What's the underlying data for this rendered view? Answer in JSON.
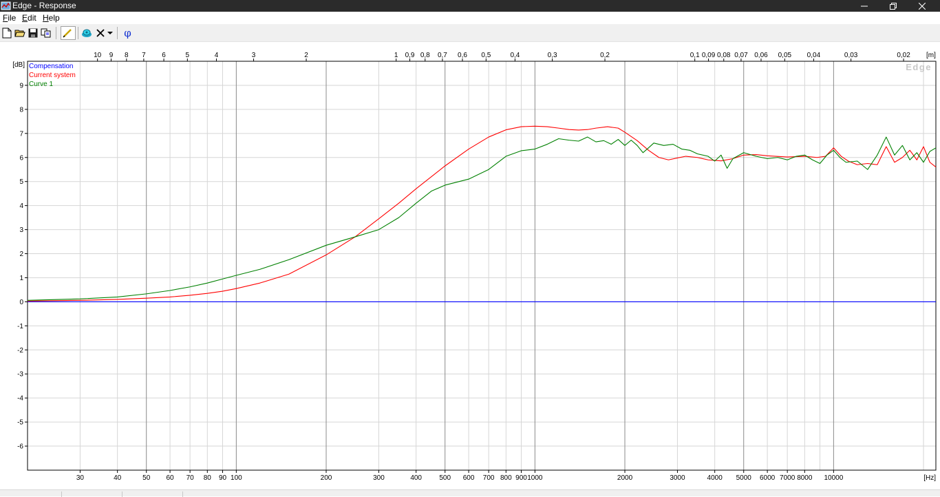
{
  "window": {
    "title": "Edge - Response"
  },
  "menu": [
    {
      "label": "File",
      "hotkey": "F",
      "rest": "ile"
    },
    {
      "label": "Edit",
      "hotkey": "E",
      "rest": "dit"
    },
    {
      "label": "Help",
      "hotkey": "H",
      "rest": "elp"
    }
  ],
  "toolbar": {
    "icons": [
      "new-document-icon",
      "open-folder-icon",
      "save-disk-icon",
      "copy-icon",
      "draw-curve-icon",
      "speaker-icon",
      "delete-x-icon",
      "dropdown-arrow-icon",
      "phase-phi-icon"
    ],
    "phase_glyph": "φ"
  },
  "chart_data": {
    "type": "line",
    "watermark": "Edge",
    "xunit": "[Hz]",
    "yunit": "[dB]",
    "topunit": "[m]",
    "xscale": "log",
    "xlim": [
      20,
      22000
    ],
    "ylim": [
      -7,
      10
    ],
    "grid": true,
    "legend_position": "top-left",
    "x_ticks": [
      {
        "v": 30,
        "label": "30"
      },
      {
        "v": 40,
        "label": "40"
      },
      {
        "v": 50,
        "label": "50"
      },
      {
        "v": 60,
        "label": "60"
      },
      {
        "v": 70,
        "label": "70"
      },
      {
        "v": 80,
        "label": "80"
      },
      {
        "v": 90,
        "label": "90"
      },
      {
        "v": 100,
        "label": "100"
      },
      {
        "v": 200,
        "label": "200"
      },
      {
        "v": 300,
        "label": "300"
      },
      {
        "v": 400,
        "label": "400"
      },
      {
        "v": 500,
        "label": "500"
      },
      {
        "v": 600,
        "label": "600"
      },
      {
        "v": 700,
        "label": "700"
      },
      {
        "v": 800,
        "label": "800"
      },
      {
        "v": 900,
        "label": "900"
      },
      {
        "v": 1000,
        "label": "1000"
      },
      {
        "v": 2000,
        "label": "2000"
      },
      {
        "v": 3000,
        "label": "3000"
      },
      {
        "v": 4000,
        "label": "4000"
      },
      {
        "v": 5000,
        "label": "5000"
      },
      {
        "v": 6000,
        "label": "6000"
      },
      {
        "v": 7000,
        "label": "7000"
      },
      {
        "v": 8000,
        "label": "8000"
      },
      {
        "v": 10000,
        "label": "10000"
      }
    ],
    "x_major": [
      50,
      100,
      200,
      500,
      1000,
      2000,
      5000,
      10000
    ],
    "y_ticks": [
      9,
      8,
      7,
      6,
      5,
      4,
      3,
      2,
      1,
      0,
      -1,
      -2,
      -3,
      -4,
      -5,
      -6
    ],
    "top_ticks": [
      {
        "label": "10",
        "v": 34.3
      },
      {
        "label": "9",
        "v": 38.1
      },
      {
        "label": "8",
        "v": 42.9
      },
      {
        "label": "7",
        "v": 49
      },
      {
        "label": "6",
        "v": 57.2
      },
      {
        "label": "5",
        "v": 68.6
      },
      {
        "label": "4",
        "v": 85.8
      },
      {
        "label": "3",
        "v": 114.3
      },
      {
        "label": "2",
        "v": 171.5
      },
      {
        "label": "1",
        "v": 343
      },
      {
        "label": "0,9",
        "v": 381.1
      },
      {
        "label": "0,8",
        "v": 428.8
      },
      {
        "label": "0,7",
        "v": 490
      },
      {
        "label": "0,6",
        "v": 571.7
      },
      {
        "label": "0,5",
        "v": 686
      },
      {
        "label": "0,4",
        "v": 857.5
      },
      {
        "label": "0,3",
        "v": 1143.3
      },
      {
        "label": "0,2",
        "v": 1715
      },
      {
        "label": "0,1",
        "v": 3430
      },
      {
        "label": "0,09",
        "v": 3811
      },
      {
        "label": "0,08",
        "v": 4287.5
      },
      {
        "label": "0,07",
        "v": 4900
      },
      {
        "label": "0,06",
        "v": 5716.7
      },
      {
        "label": "0,05",
        "v": 6860
      },
      {
        "label": "0,04",
        "v": 8575
      },
      {
        "label": "0,03",
        "v": 11433
      },
      {
        "label": "0,02",
        "v": 17150
      }
    ],
    "series": [
      {
        "name": "Compensation",
        "color": "#0000ff",
        "points": [
          [
            20,
            0
          ],
          [
            22000,
            0
          ]
        ]
      },
      {
        "name": "Current system",
        "color": "#ff0000",
        "points": [
          [
            20,
            0.03
          ],
          [
            30,
            0.06
          ],
          [
            40,
            0.1
          ],
          [
            50,
            0.15
          ],
          [
            60,
            0.2
          ],
          [
            70,
            0.27
          ],
          [
            80,
            0.35
          ],
          [
            90,
            0.44
          ],
          [
            100,
            0.55
          ],
          [
            120,
            0.78
          ],
          [
            150,
            1.15
          ],
          [
            200,
            1.95
          ],
          [
            250,
            2.7
          ],
          [
            300,
            3.45
          ],
          [
            350,
            4.1
          ],
          [
            400,
            4.7
          ],
          [
            450,
            5.2
          ],
          [
            500,
            5.65
          ],
          [
            600,
            6.35
          ],
          [
            700,
            6.85
          ],
          [
            800,
            7.15
          ],
          [
            900,
            7.28
          ],
          [
            1000,
            7.3
          ],
          [
            1100,
            7.28
          ],
          [
            1200,
            7.22
          ],
          [
            1300,
            7.16
          ],
          [
            1400,
            7.14
          ],
          [
            1500,
            7.16
          ],
          [
            1600,
            7.22
          ],
          [
            1750,
            7.28
          ],
          [
            1900,
            7.22
          ],
          [
            2000,
            7.05
          ],
          [
            2200,
            6.7
          ],
          [
            2400,
            6.3
          ],
          [
            2600,
            6.0
          ],
          [
            2800,
            5.9
          ],
          [
            3000,
            5.98
          ],
          [
            3200,
            6.05
          ],
          [
            3500,
            6.0
          ],
          [
            3800,
            5.9
          ],
          [
            4200,
            5.86
          ],
          [
            4600,
            5.95
          ],
          [
            5000,
            6.1
          ],
          [
            5500,
            6.12
          ],
          [
            6000,
            6.07
          ],
          [
            7000,
            6.02
          ],
          [
            8000,
            6.05
          ],
          [
            8800,
            6.0
          ],
          [
            9400,
            6.05
          ],
          [
            10000,
            6.4
          ],
          [
            10600,
            6.05
          ],
          [
            11200,
            5.85
          ],
          [
            12000,
            5.7
          ],
          [
            13000,
            5.75
          ],
          [
            14000,
            5.7
          ],
          [
            15000,
            6.45
          ],
          [
            16000,
            5.8
          ],
          [
            17000,
            6.0
          ],
          [
            18000,
            6.3
          ],
          [
            19000,
            5.9
          ],
          [
            20000,
            6.45
          ],
          [
            21000,
            5.8
          ],
          [
            22000,
            5.6
          ]
        ]
      },
      {
        "name": "Curve 1",
        "color": "#008000",
        "points": [
          [
            20,
            0.06
          ],
          [
            30,
            0.12
          ],
          [
            40,
            0.2
          ],
          [
            50,
            0.33
          ],
          [
            60,
            0.47
          ],
          [
            70,
            0.62
          ],
          [
            80,
            0.78
          ],
          [
            90,
            0.95
          ],
          [
            100,
            1.1
          ],
          [
            120,
            1.35
          ],
          [
            150,
            1.75
          ],
          [
            200,
            2.35
          ],
          [
            250,
            2.7
          ],
          [
            300,
            3.0
          ],
          [
            350,
            3.5
          ],
          [
            400,
            4.1
          ],
          [
            450,
            4.6
          ],
          [
            500,
            4.85
          ],
          [
            600,
            5.1
          ],
          [
            700,
            5.5
          ],
          [
            800,
            6.05
          ],
          [
            900,
            6.28
          ],
          [
            1000,
            6.35
          ],
          [
            1100,
            6.55
          ],
          [
            1200,
            6.78
          ],
          [
            1300,
            6.72
          ],
          [
            1400,
            6.68
          ],
          [
            1500,
            6.85
          ],
          [
            1600,
            6.65
          ],
          [
            1700,
            6.7
          ],
          [
            1800,
            6.55
          ],
          [
            1900,
            6.75
          ],
          [
            2000,
            6.5
          ],
          [
            2100,
            6.72
          ],
          [
            2200,
            6.5
          ],
          [
            2300,
            6.2
          ],
          [
            2400,
            6.4
          ],
          [
            2500,
            6.6
          ],
          [
            2700,
            6.5
          ],
          [
            2900,
            6.55
          ],
          [
            3100,
            6.35
          ],
          [
            3300,
            6.3
          ],
          [
            3500,
            6.15
          ],
          [
            3800,
            6.05
          ],
          [
            4000,
            5.85
          ],
          [
            4200,
            6.1
          ],
          [
            4400,
            5.55
          ],
          [
            4600,
            5.95
          ],
          [
            5000,
            6.2
          ],
          [
            5500,
            6.05
          ],
          [
            6000,
            5.95
          ],
          [
            6500,
            6.0
          ],
          [
            7000,
            5.9
          ],
          [
            7500,
            6.05
          ],
          [
            8000,
            6.1
          ],
          [
            8500,
            5.9
          ],
          [
            9000,
            5.75
          ],
          [
            9500,
            6.1
          ],
          [
            10000,
            6.3
          ],
          [
            10500,
            6.0
          ],
          [
            11000,
            5.8
          ],
          [
            12000,
            5.85
          ],
          [
            13000,
            5.5
          ],
          [
            14000,
            6.1
          ],
          [
            15000,
            6.85
          ],
          [
            16000,
            6.1
          ],
          [
            17000,
            6.5
          ],
          [
            18000,
            5.9
          ],
          [
            19000,
            6.2
          ],
          [
            20000,
            5.8
          ],
          [
            21000,
            6.25
          ],
          [
            22000,
            6.4
          ]
        ]
      }
    ]
  }
}
